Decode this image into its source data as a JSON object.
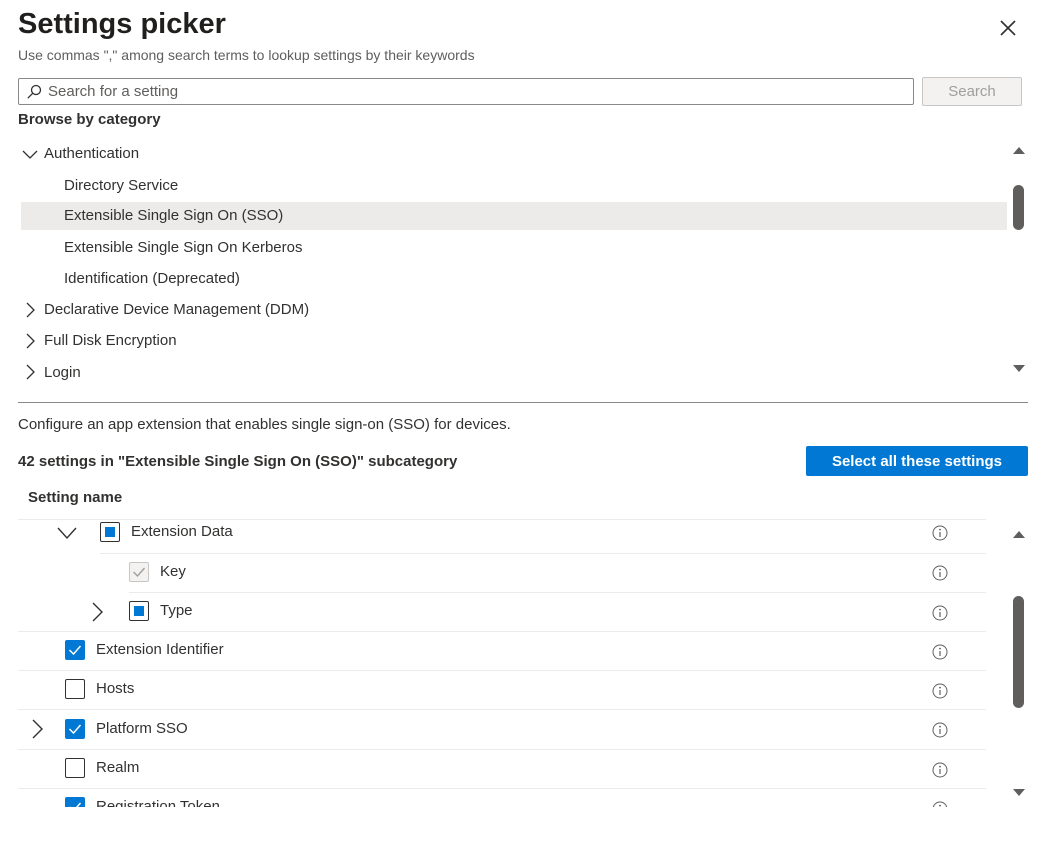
{
  "header": {
    "title": "Settings picker",
    "subtitle": "Use commas \",\" among search terms to lookup settings by their keywords"
  },
  "search": {
    "placeholder": "Search for a setting",
    "button_label": "Search"
  },
  "browse": {
    "label": "Browse by category",
    "tree": [
      {
        "label": "Authentication",
        "expanded": true
      },
      {
        "label": "Directory Service"
      },
      {
        "label": "Extensible Single Sign On (SSO)",
        "selected": true
      },
      {
        "label": "Extensible Single Sign On Kerberos"
      },
      {
        "label": "Identification (Deprecated)"
      },
      {
        "label": "Declarative Device Management (DDM)",
        "expanded": false
      },
      {
        "label": "Full Disk Encryption",
        "expanded": false
      },
      {
        "label": "Login",
        "expanded": false
      }
    ]
  },
  "details": {
    "description": "Configure an app extension that enables single sign-on (SSO) for devices.",
    "count_text": "42 settings in \"Extensible Single Sign On (SSO)\" subcategory",
    "select_all_label": "Select all these settings",
    "column_header": "Setting name",
    "settings": [
      {
        "label": "Extension Data",
        "state": "indeterminate",
        "expanded": true
      },
      {
        "label": "Key",
        "state": "disabled-checked"
      },
      {
        "label": "Type",
        "state": "indeterminate",
        "expanded": false
      },
      {
        "label": "Extension Identifier",
        "state": "checked"
      },
      {
        "label": "Hosts",
        "state": "unchecked"
      },
      {
        "label": "Platform SSO",
        "state": "checked",
        "expanded": false
      },
      {
        "label": "Realm",
        "state": "unchecked"
      },
      {
        "label": "Registration Token",
        "state": "checked"
      }
    ]
  },
  "colors": {
    "accent": "#0078d4",
    "selected_row": "#edebe9",
    "text": "#323130"
  }
}
